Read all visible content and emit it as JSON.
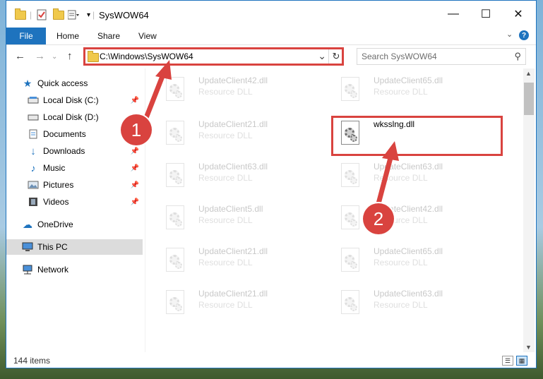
{
  "window": {
    "title": "SysWOW64",
    "controls": {
      "minimize": "—",
      "maximize": "☐",
      "close": "✕"
    }
  },
  "ribbon": {
    "file_tab": "File",
    "tabs": [
      "Home",
      "Share",
      "View"
    ],
    "help": "?"
  },
  "address_bar": {
    "path": "C:\\Windows\\SysWOW64",
    "dropdown": "⌄",
    "refresh": "↻"
  },
  "search": {
    "placeholder": "Search SysWOW64"
  },
  "sidebar": {
    "quick_access": "Quick access",
    "items": [
      {
        "label": "Local Disk (C:)",
        "icon": "drive-icon",
        "pinned": true
      },
      {
        "label": "Local Disk (D:)",
        "icon": "drive-icon",
        "pinned": false
      },
      {
        "label": "Documents",
        "icon": "documents-icon",
        "pinned": true
      },
      {
        "label": "Downloads",
        "icon": "downloads-icon",
        "pinned": true
      },
      {
        "label": "Music",
        "icon": "music-icon",
        "pinned": true
      },
      {
        "label": "Pictures",
        "icon": "pictures-icon",
        "pinned": true
      },
      {
        "label": "Videos",
        "icon": "videos-icon",
        "pinned": true
      }
    ],
    "onedrive": "OneDrive",
    "this_pc": "This PC",
    "network": "Network"
  },
  "files": {
    "left_column": [
      {
        "name": "UpdateClient42.dll",
        "type": "Resource DLL"
      },
      {
        "name": "UpdateClient21.dll",
        "type": "Resource DLL"
      },
      {
        "name": "UpdateClient63.dll",
        "type": "Resource DLL"
      },
      {
        "name": "UpdateClient5.dll",
        "type": "Resource DLL"
      },
      {
        "name": "UpdateClient21.dll",
        "type": "Resource DLL"
      },
      {
        "name": "UpdateClient21.dll",
        "type": "Resource DLL"
      }
    ],
    "right_column": [
      {
        "name": "UpdateClient65.dll",
        "type": "Resource DLL"
      },
      {
        "name": "wksslng.dll",
        "type": ""
      },
      {
        "name": "UpdateClient63.dll",
        "type": "Resource DLL"
      },
      {
        "name": "UpdateClient42.dll",
        "type": "Resource DLL"
      },
      {
        "name": "UpdateClient65.dll",
        "type": "Resource DLL"
      },
      {
        "name": "UpdateClient63.dll",
        "type": "Resource DLL"
      }
    ]
  },
  "status_bar": {
    "item_count": "144 items"
  },
  "annotations": {
    "step1": "1",
    "step2": "2",
    "color": "#d9433f"
  },
  "colors": {
    "accent": "#1e73be",
    "highlight": "#d9433f"
  }
}
